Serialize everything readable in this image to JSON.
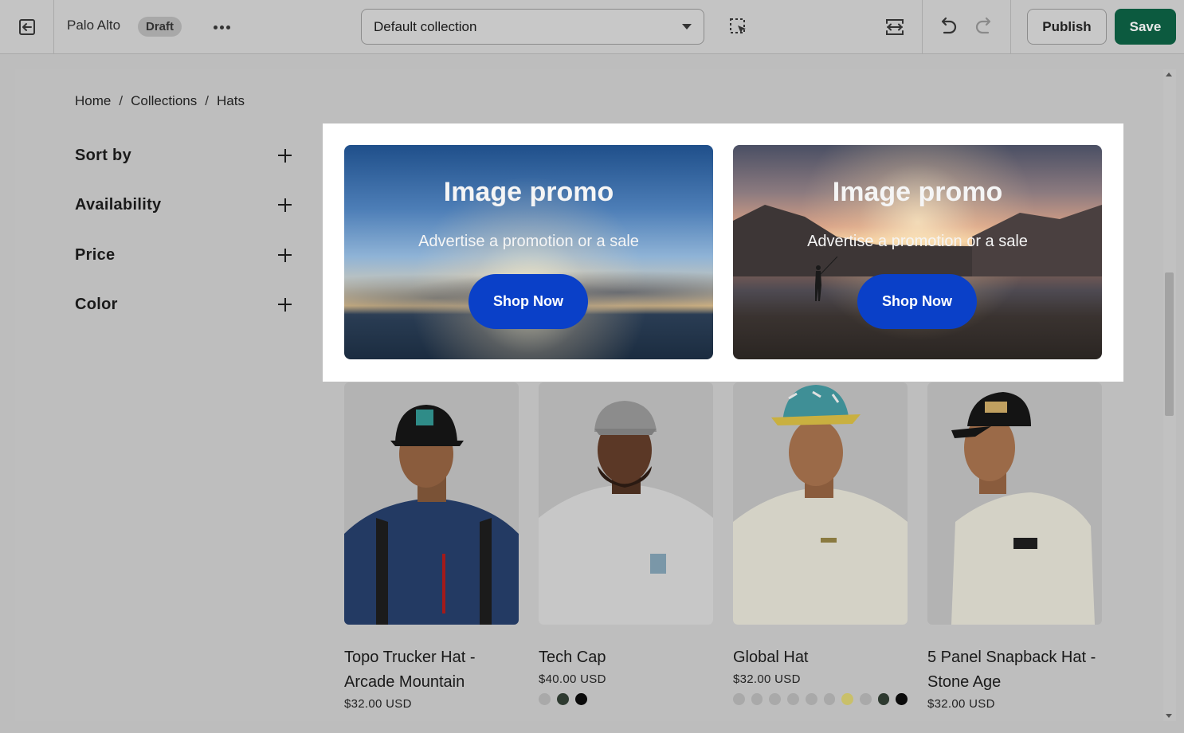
{
  "topbar": {
    "store_name": "Palo Alto",
    "status_badge": "Draft",
    "template_select": "Default collection",
    "publish_label": "Publish",
    "save_label": "Save",
    "save_color": "#0c5a3f"
  },
  "preview": {
    "breadcrumb": [
      "Home",
      "Collections",
      "Hats"
    ],
    "filters": [
      "Sort by",
      "Availability",
      "Price",
      "Color"
    ],
    "promos": [
      {
        "title": "Image promo",
        "subtitle": "Advertise a promotion or a sale",
        "button": "Shop Now"
      },
      {
        "title": "Image promo",
        "subtitle": "Advertise a promotion or a sale",
        "button": "Shop Now"
      }
    ],
    "promo_button_color": "#0a40c8",
    "products": [
      {
        "name": "Topo Trucker Hat - Arcade Mountain",
        "price": "$32.00 USD",
        "swatches": []
      },
      {
        "name": "Tech Cap",
        "price": "$40.00 USD",
        "swatches": [
          "#a9a9a9",
          "#2e3a30",
          "#0b0b0b"
        ]
      },
      {
        "name": "Global Hat",
        "price": "$32.00 USD",
        "swatches": [
          "#a9a9a9",
          "#a9a9a9",
          "#a9a9a9",
          "#a9a9a9",
          "#a9a9a9",
          "#a9a9a9",
          "#c9c06a",
          "#a9a9a9",
          "#2e3a30",
          "#0b0b0b"
        ]
      },
      {
        "name": "5 Panel Snapback Hat - Stone Age",
        "price": "$32.00 USD",
        "swatches": []
      }
    ]
  }
}
